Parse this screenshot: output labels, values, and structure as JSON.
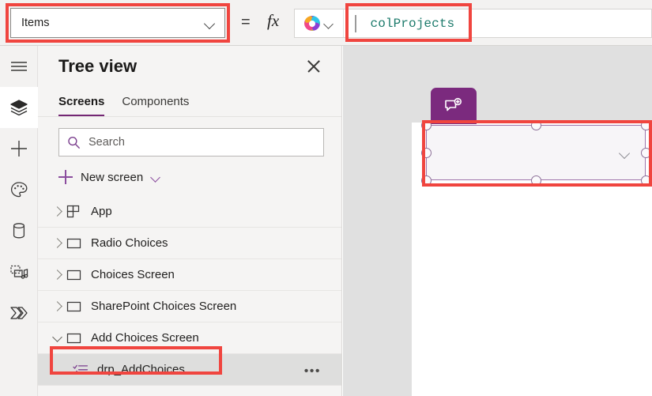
{
  "formula_bar": {
    "property_select": {
      "value": "Items",
      "icon": "chevron-down-icon"
    },
    "equals": "=",
    "fx": "fx",
    "copilot_icon": "copilot-icon",
    "copilot_chevron": "chevron-down-icon",
    "formula_text": "colProjects",
    "formula_color": "#1c7a6b"
  },
  "rail": {
    "items": [
      {
        "name": "hamburger-menu-icon",
        "active": false
      },
      {
        "name": "tree-view-layers-icon",
        "active": true
      },
      {
        "name": "insert-plus-icon",
        "active": false
      },
      {
        "name": "theme-palette-icon",
        "active": false
      },
      {
        "name": "data-sources-icon",
        "active": false
      },
      {
        "name": "media-icon",
        "active": false
      },
      {
        "name": "power-automate-icon",
        "active": false
      }
    ]
  },
  "tree_view": {
    "title": "Tree view",
    "close_icon": "close-icon",
    "tabs": [
      {
        "label": "Screens",
        "selected": true
      },
      {
        "label": "Components",
        "selected": false
      }
    ],
    "search": {
      "placeholder": "Search",
      "value": "",
      "icon": "search-icon"
    },
    "new_screen": {
      "label": "New screen",
      "plus_icon": "plus-icon",
      "chevron_icon": "chevron-down-icon"
    },
    "items": [
      {
        "label": "App",
        "icon": "app-grid-icon",
        "expander": "right",
        "indent": 0,
        "selected": false
      },
      {
        "label": "Radio Choices",
        "icon": "screen-icon",
        "expander": "right",
        "indent": 0,
        "selected": false
      },
      {
        "label": "Choices Screen",
        "icon": "screen-icon",
        "expander": "right",
        "indent": 0,
        "selected": false
      },
      {
        "label": "SharePoint Choices Screen",
        "icon": "screen-icon",
        "expander": "right",
        "indent": 0,
        "selected": false
      },
      {
        "label": "Add Choices Screen",
        "icon": "screen-icon",
        "expander": "down",
        "indent": 0,
        "selected": false
      },
      {
        "label": "drp_AddChoices",
        "icon": "dropdown-list-icon",
        "expander": "none",
        "indent": 1,
        "selected": true,
        "more_label": "•••"
      }
    ]
  },
  "canvas": {
    "background_color": "#e0e0e0",
    "screen_color": "#ffffff",
    "copilot_badge": {
      "icon": "copilot-chat-add-icon",
      "color": "#7b2a7e"
    },
    "selected_control": {
      "name": "drp_AddChoices",
      "type": "dropdown",
      "chevron_icon": "chevron-down-icon",
      "border_color": "#9f75ab",
      "handle_count": 8
    }
  },
  "annotations": {
    "color": "#f0453f",
    "boxes": [
      {
        "target": "property-select"
      },
      {
        "target": "formula-text"
      },
      {
        "target": "canvas-selected-control"
      },
      {
        "target": "tree-item-drp-addchoices"
      }
    ]
  }
}
